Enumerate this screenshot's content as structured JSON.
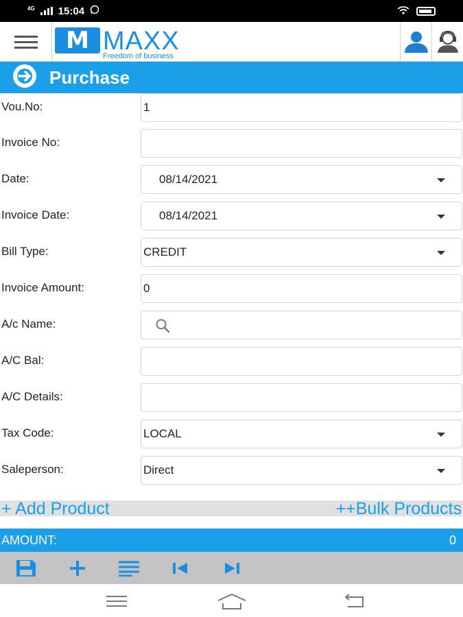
{
  "status_bar": {
    "network": "4G",
    "time": "15:04"
  },
  "header": {
    "logo_mark": "M",
    "logo_word": "MAXX",
    "logo_tagline": "Freedom of business"
  },
  "page": {
    "title": "Purchase"
  },
  "form": {
    "vou_no": {
      "label": "Vou.No:",
      "value": "1"
    },
    "invoice_no": {
      "label": "Invoice No:",
      "value": ""
    },
    "date": {
      "label": "Date:",
      "value": "08/14/2021"
    },
    "invoice_date": {
      "label": "Invoice Date:",
      "value": "08/14/2021"
    },
    "bill_type": {
      "label": "Bill Type:",
      "value": "CREDIT"
    },
    "invoice_amount": {
      "label": "Invoice Amount:",
      "value": "0"
    },
    "ac_name": {
      "label": "A/c Name:",
      "value": ""
    },
    "ac_bal": {
      "label": "A/C Bal:",
      "value": ""
    },
    "ac_details": {
      "label": "A/C Details:",
      "value": ""
    },
    "tax_code": {
      "label": "Tax Code:",
      "value": "LOCAL"
    },
    "saleperson": {
      "label": "Saleperson:",
      "value": "Direct"
    }
  },
  "products": {
    "add_label": "+ Add Product",
    "bulk_label": "++Bulk Products"
  },
  "amount": {
    "label": "AMOUNT:",
    "value": "0"
  },
  "toolbar": {
    "icons": [
      "save-icon",
      "add-icon",
      "list-icon",
      "first-record-icon",
      "last-record-icon"
    ]
  },
  "colors": {
    "accent": "#1aa0e8",
    "logo_blue": "#1c8ee0",
    "toolbar_bg": "#c3c3c3"
  }
}
